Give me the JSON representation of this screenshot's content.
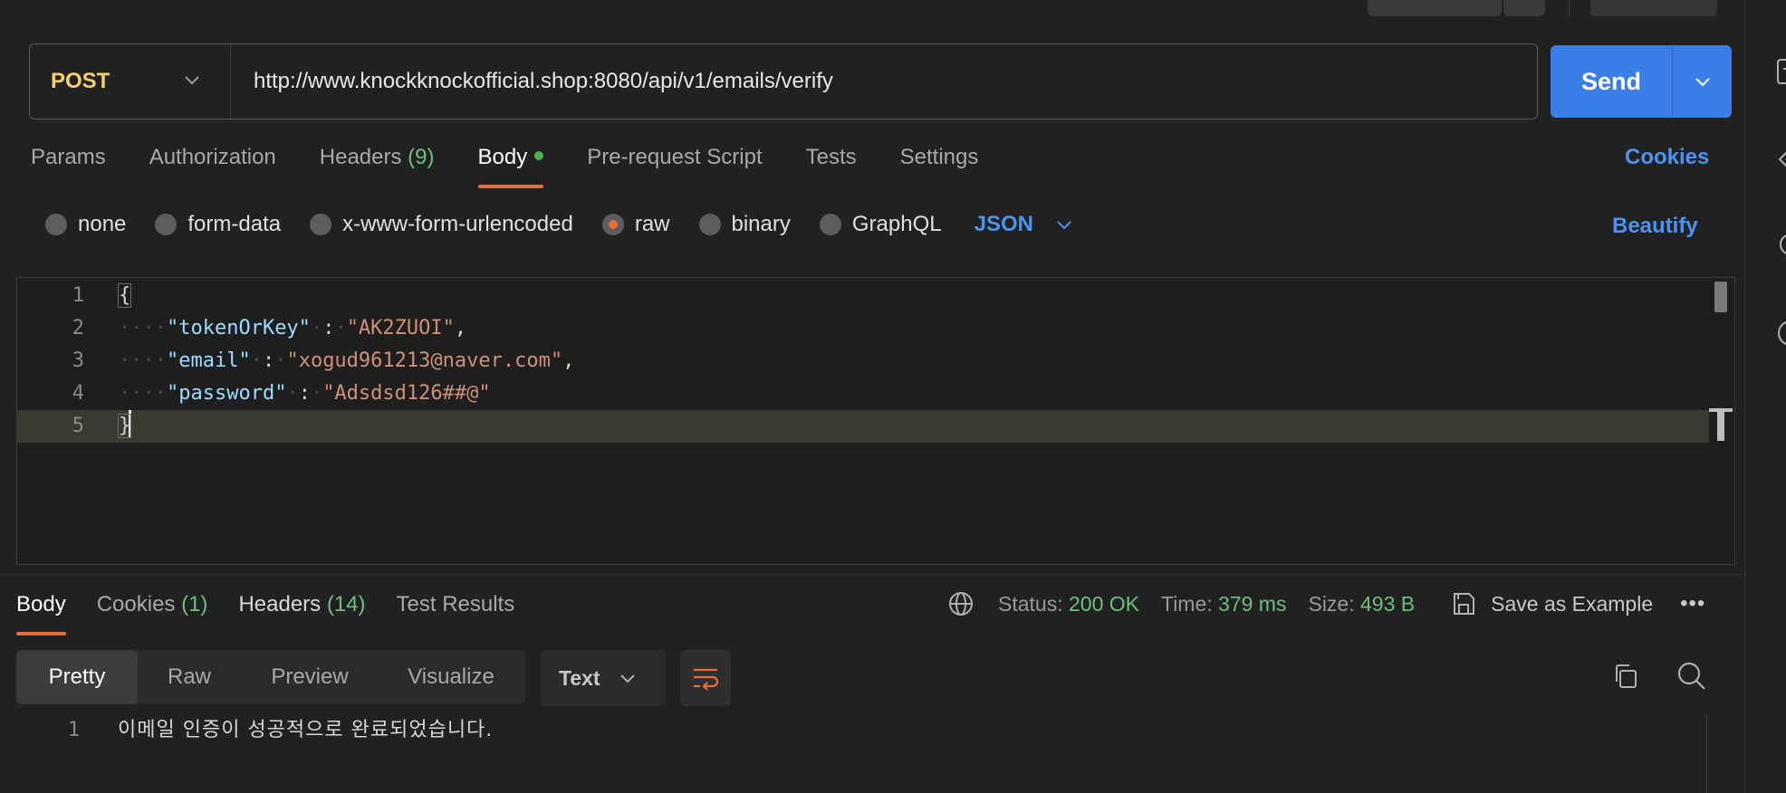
{
  "request": {
    "method": "POST",
    "url": "http://www.knockknockofficial.shop:8080/api/v1/emails/verify",
    "send_label": "Send"
  },
  "request_tabs": [
    {
      "label": "Params"
    },
    {
      "label": "Authorization"
    },
    {
      "label": "Headers",
      "count": "(9)"
    },
    {
      "label": "Body",
      "active": true,
      "dot": true
    },
    {
      "label": "Pre-request Script"
    },
    {
      "label": "Tests"
    },
    {
      "label": "Settings"
    }
  ],
  "cookies_label": "Cookies",
  "body_types": [
    {
      "label": "none"
    },
    {
      "label": "form-data"
    },
    {
      "label": "x-www-form-urlencoded"
    },
    {
      "label": "raw",
      "selected": true
    },
    {
      "label": "binary"
    },
    {
      "label": "GraphQL"
    }
  ],
  "body_format": "JSON",
  "beautify_label": "Beautify",
  "editor": {
    "lines": [
      {
        "n": "1",
        "text": "{"
      },
      {
        "n": "2",
        "key": "\"tokenOrKey\"",
        "value": "\"AK2ZUOI\"",
        "trail": ","
      },
      {
        "n": "3",
        "key": "\"email\"",
        "value": "\"xogud961213@naver.com\"",
        "trail": ","
      },
      {
        "n": "4",
        "key": "\"password\"",
        "value": "\"Adsdsd126##@\"",
        "trail": ""
      },
      {
        "n": "5",
        "text": "}"
      }
    ]
  },
  "response_tabs": [
    {
      "label": "Body",
      "active": true
    },
    {
      "label": "Cookies",
      "count": "(1)"
    },
    {
      "label": "Headers",
      "count": "(14)"
    },
    {
      "label": "Test Results"
    }
  ],
  "response_meta": {
    "status_label": "Status:",
    "status_value": "200 OK",
    "time_label": "Time:",
    "time_value": "379 ms",
    "size_label": "Size:",
    "size_value": "493 B",
    "save_example": "Save as Example",
    "more": "•••"
  },
  "view_modes": [
    {
      "label": "Pretty",
      "active": true
    },
    {
      "label": "Raw"
    },
    {
      "label": "Preview"
    },
    {
      "label": "Visualize"
    }
  ],
  "response_format": "Text",
  "response_body": [
    {
      "n": "1",
      "text": "이메일 인증이 성공적으로 완료되었습니다."
    }
  ],
  "colors": {
    "accent_orange": "#e86d3c",
    "send_blue": "#3b7ee8",
    "link_blue": "#4d93f0",
    "method_yellow": "#f4d06f",
    "count_green": "#6dbf7b"
  },
  "icons": [
    "chevron-down-icon",
    "globe-icon",
    "save-icon",
    "wrap-lines-icon",
    "copy-icon",
    "search-icon"
  ]
}
